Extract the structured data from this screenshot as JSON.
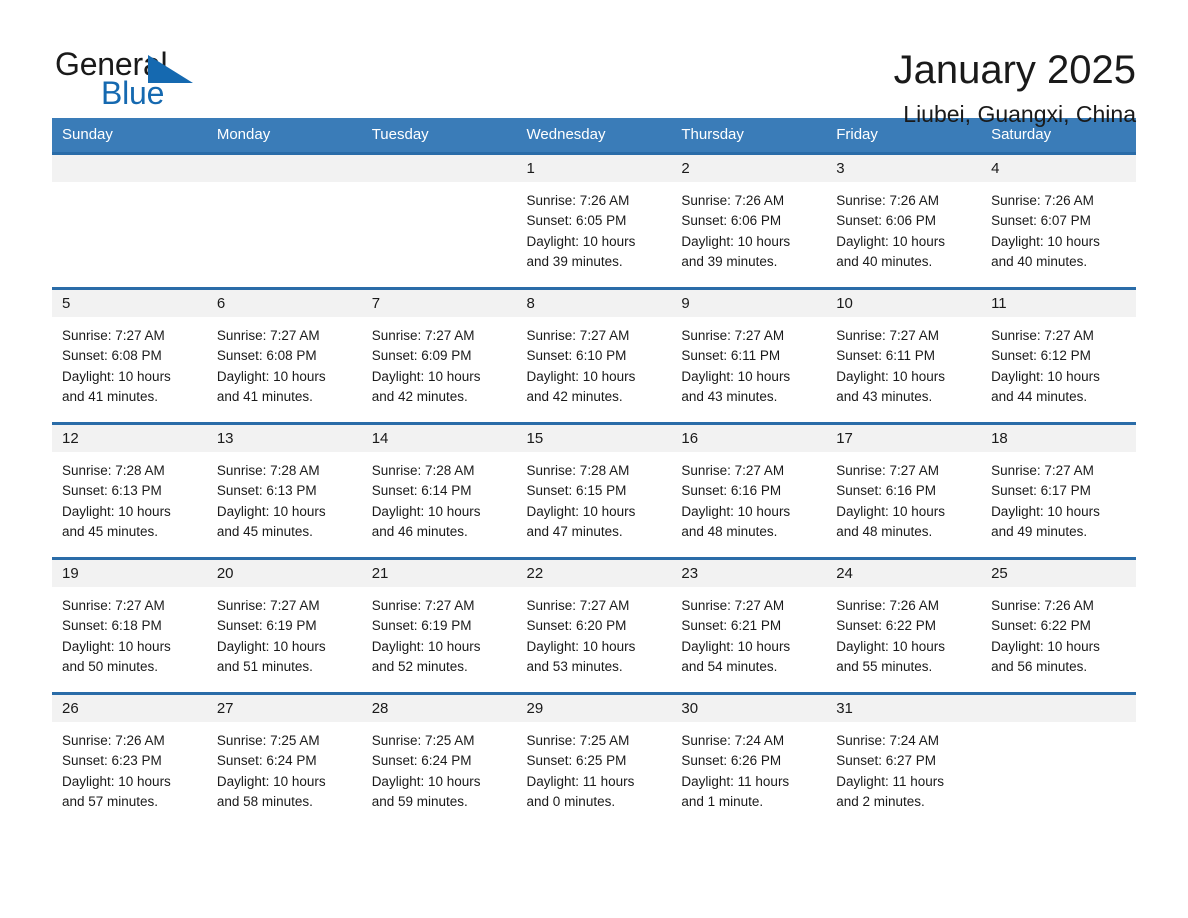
{
  "brand": {
    "name_part1": "General",
    "name_part2": "Blue",
    "triangle_color": "#1569b0"
  },
  "header": {
    "month_title": "January 2025",
    "location": "Liubei, Guangxi, China"
  },
  "theme": {
    "header_bg": "#3a7cb8",
    "row_border": "#2a6ca8",
    "daynum_bg": "#f2f2f2",
    "text": "#1a1a1a"
  },
  "weekday_headers": [
    "Sunday",
    "Monday",
    "Tuesday",
    "Wednesday",
    "Thursday",
    "Friday",
    "Saturday"
  ],
  "weeks": [
    [
      {
        "day": "",
        "sunrise": "",
        "sunset": "",
        "daylight1": "",
        "daylight2": ""
      },
      {
        "day": "",
        "sunrise": "",
        "sunset": "",
        "daylight1": "",
        "daylight2": ""
      },
      {
        "day": "",
        "sunrise": "",
        "sunset": "",
        "daylight1": "",
        "daylight2": ""
      },
      {
        "day": "1",
        "sunrise": "Sunrise: 7:26 AM",
        "sunset": "Sunset: 6:05 PM",
        "daylight1": "Daylight: 10 hours",
        "daylight2": "and 39 minutes."
      },
      {
        "day": "2",
        "sunrise": "Sunrise: 7:26 AM",
        "sunset": "Sunset: 6:06 PM",
        "daylight1": "Daylight: 10 hours",
        "daylight2": "and 39 minutes."
      },
      {
        "day": "3",
        "sunrise": "Sunrise: 7:26 AM",
        "sunset": "Sunset: 6:06 PM",
        "daylight1": "Daylight: 10 hours",
        "daylight2": "and 40 minutes."
      },
      {
        "day": "4",
        "sunrise": "Sunrise: 7:26 AM",
        "sunset": "Sunset: 6:07 PM",
        "daylight1": "Daylight: 10 hours",
        "daylight2": "and 40 minutes."
      }
    ],
    [
      {
        "day": "5",
        "sunrise": "Sunrise: 7:27 AM",
        "sunset": "Sunset: 6:08 PM",
        "daylight1": "Daylight: 10 hours",
        "daylight2": "and 41 minutes."
      },
      {
        "day": "6",
        "sunrise": "Sunrise: 7:27 AM",
        "sunset": "Sunset: 6:08 PM",
        "daylight1": "Daylight: 10 hours",
        "daylight2": "and 41 minutes."
      },
      {
        "day": "7",
        "sunrise": "Sunrise: 7:27 AM",
        "sunset": "Sunset: 6:09 PM",
        "daylight1": "Daylight: 10 hours",
        "daylight2": "and 42 minutes."
      },
      {
        "day": "8",
        "sunrise": "Sunrise: 7:27 AM",
        "sunset": "Sunset: 6:10 PM",
        "daylight1": "Daylight: 10 hours",
        "daylight2": "and 42 minutes."
      },
      {
        "day": "9",
        "sunrise": "Sunrise: 7:27 AM",
        "sunset": "Sunset: 6:11 PM",
        "daylight1": "Daylight: 10 hours",
        "daylight2": "and 43 minutes."
      },
      {
        "day": "10",
        "sunrise": "Sunrise: 7:27 AM",
        "sunset": "Sunset: 6:11 PM",
        "daylight1": "Daylight: 10 hours",
        "daylight2": "and 43 minutes."
      },
      {
        "day": "11",
        "sunrise": "Sunrise: 7:27 AM",
        "sunset": "Sunset: 6:12 PM",
        "daylight1": "Daylight: 10 hours",
        "daylight2": "and 44 minutes."
      }
    ],
    [
      {
        "day": "12",
        "sunrise": "Sunrise: 7:28 AM",
        "sunset": "Sunset: 6:13 PM",
        "daylight1": "Daylight: 10 hours",
        "daylight2": "and 45 minutes."
      },
      {
        "day": "13",
        "sunrise": "Sunrise: 7:28 AM",
        "sunset": "Sunset: 6:13 PM",
        "daylight1": "Daylight: 10 hours",
        "daylight2": "and 45 minutes."
      },
      {
        "day": "14",
        "sunrise": "Sunrise: 7:28 AM",
        "sunset": "Sunset: 6:14 PM",
        "daylight1": "Daylight: 10 hours",
        "daylight2": "and 46 minutes."
      },
      {
        "day": "15",
        "sunrise": "Sunrise: 7:28 AM",
        "sunset": "Sunset: 6:15 PM",
        "daylight1": "Daylight: 10 hours",
        "daylight2": "and 47 minutes."
      },
      {
        "day": "16",
        "sunrise": "Sunrise: 7:27 AM",
        "sunset": "Sunset: 6:16 PM",
        "daylight1": "Daylight: 10 hours",
        "daylight2": "and 48 minutes."
      },
      {
        "day": "17",
        "sunrise": "Sunrise: 7:27 AM",
        "sunset": "Sunset: 6:16 PM",
        "daylight1": "Daylight: 10 hours",
        "daylight2": "and 48 minutes."
      },
      {
        "day": "18",
        "sunrise": "Sunrise: 7:27 AM",
        "sunset": "Sunset: 6:17 PM",
        "daylight1": "Daylight: 10 hours",
        "daylight2": "and 49 minutes."
      }
    ],
    [
      {
        "day": "19",
        "sunrise": "Sunrise: 7:27 AM",
        "sunset": "Sunset: 6:18 PM",
        "daylight1": "Daylight: 10 hours",
        "daylight2": "and 50 minutes."
      },
      {
        "day": "20",
        "sunrise": "Sunrise: 7:27 AM",
        "sunset": "Sunset: 6:19 PM",
        "daylight1": "Daylight: 10 hours",
        "daylight2": "and 51 minutes."
      },
      {
        "day": "21",
        "sunrise": "Sunrise: 7:27 AM",
        "sunset": "Sunset: 6:19 PM",
        "daylight1": "Daylight: 10 hours",
        "daylight2": "and 52 minutes."
      },
      {
        "day": "22",
        "sunrise": "Sunrise: 7:27 AM",
        "sunset": "Sunset: 6:20 PM",
        "daylight1": "Daylight: 10 hours",
        "daylight2": "and 53 minutes."
      },
      {
        "day": "23",
        "sunrise": "Sunrise: 7:27 AM",
        "sunset": "Sunset: 6:21 PM",
        "daylight1": "Daylight: 10 hours",
        "daylight2": "and 54 minutes."
      },
      {
        "day": "24",
        "sunrise": "Sunrise: 7:26 AM",
        "sunset": "Sunset: 6:22 PM",
        "daylight1": "Daylight: 10 hours",
        "daylight2": "and 55 minutes."
      },
      {
        "day": "25",
        "sunrise": "Sunrise: 7:26 AM",
        "sunset": "Sunset: 6:22 PM",
        "daylight1": "Daylight: 10 hours",
        "daylight2": "and 56 minutes."
      }
    ],
    [
      {
        "day": "26",
        "sunrise": "Sunrise: 7:26 AM",
        "sunset": "Sunset: 6:23 PM",
        "daylight1": "Daylight: 10 hours",
        "daylight2": "and 57 minutes."
      },
      {
        "day": "27",
        "sunrise": "Sunrise: 7:25 AM",
        "sunset": "Sunset: 6:24 PM",
        "daylight1": "Daylight: 10 hours",
        "daylight2": "and 58 minutes."
      },
      {
        "day": "28",
        "sunrise": "Sunrise: 7:25 AM",
        "sunset": "Sunset: 6:24 PM",
        "daylight1": "Daylight: 10 hours",
        "daylight2": "and 59 minutes."
      },
      {
        "day": "29",
        "sunrise": "Sunrise: 7:25 AM",
        "sunset": "Sunset: 6:25 PM",
        "daylight1": "Daylight: 11 hours",
        "daylight2": "and 0 minutes."
      },
      {
        "day": "30",
        "sunrise": "Sunrise: 7:24 AM",
        "sunset": "Sunset: 6:26 PM",
        "daylight1": "Daylight: 11 hours",
        "daylight2": "and 1 minute."
      },
      {
        "day": "31",
        "sunrise": "Sunrise: 7:24 AM",
        "sunset": "Sunset: 6:27 PM",
        "daylight1": "Daylight: 11 hours",
        "daylight2": "and 2 minutes."
      },
      {
        "day": "",
        "sunrise": "",
        "sunset": "",
        "daylight1": "",
        "daylight2": ""
      }
    ]
  ]
}
